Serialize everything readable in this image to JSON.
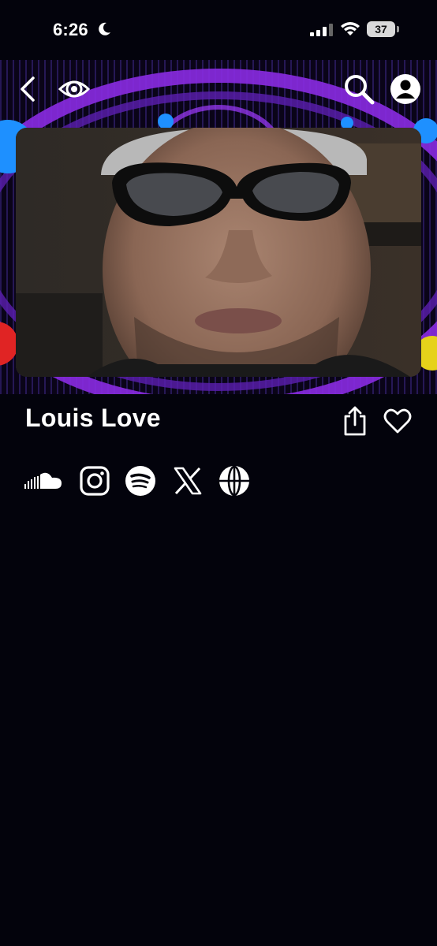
{
  "status_bar": {
    "time": "6:26",
    "battery_level": "37"
  },
  "topbar": {
    "icons": [
      "back-icon",
      "logo-icon",
      "search-icon",
      "account-icon"
    ]
  },
  "profile": {
    "name": "Louis Love",
    "actions": [
      "share-icon",
      "heart-icon"
    ]
  },
  "social_links": [
    "soundcloud-icon",
    "instagram-icon",
    "spotify-icon",
    "x-icon",
    "globe-icon"
  ],
  "colors": {
    "background": "#03030c",
    "accent_purple": "#8a2be2",
    "accent_blue": "#1e90ff",
    "accent_red": "#e02424",
    "accent_yellow": "#e6d21a"
  }
}
